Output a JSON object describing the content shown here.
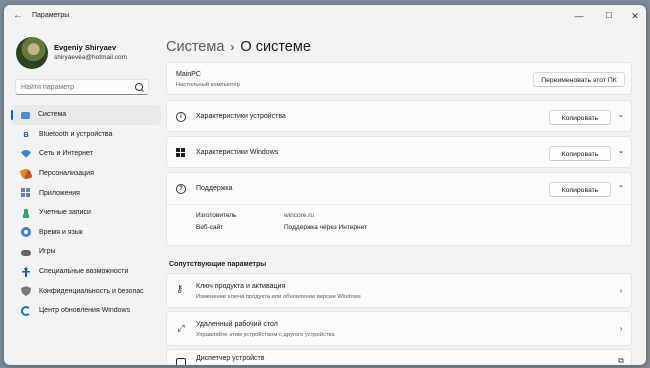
{
  "window": {
    "title": "Параметры",
    "back_glyph": "←",
    "controls": {
      "minimize": "—",
      "maximize": "☐",
      "close": "✕"
    }
  },
  "profile": {
    "name": "Evgeniy Shiryaev",
    "email": "shiryaevea@hotmail.com"
  },
  "search": {
    "placeholder": "Найти параметр"
  },
  "sidebar": {
    "items": [
      {
        "label": "Система",
        "icon": "system-icon",
        "active": true
      },
      {
        "label": "Bluetooth и устройства",
        "icon": "bluetooth-icon"
      },
      {
        "label": "Сеть и Интернет",
        "icon": "network-icon"
      },
      {
        "label": "Персонализация",
        "icon": "personalization-icon"
      },
      {
        "label": "Приложения",
        "icon": "apps-icon"
      },
      {
        "label": "Учетные записи",
        "icon": "accounts-icon"
      },
      {
        "label": "Время и язык",
        "icon": "time-language-icon"
      },
      {
        "label": "Игры",
        "icon": "games-icon"
      },
      {
        "label": "Специальные возможности",
        "icon": "accessibility-icon"
      },
      {
        "label": "Конфиденциальность и безопас",
        "icon": "privacy-icon"
      },
      {
        "label": "Центр обновления Windows",
        "icon": "windows-update-icon"
      }
    ]
  },
  "breadcrumb": {
    "parent": "Система",
    "separator": "›",
    "current": "О системе"
  },
  "device": {
    "name": "MainPC",
    "type": "Настольный компьютер",
    "rename_label": "Переименовать этот ПК"
  },
  "sections": {
    "device_specs": {
      "title": "Характеристики устройства",
      "copy_label": "Копировать"
    },
    "windows_specs": {
      "title": "Характеристики Windows",
      "copy_label": "Копировать"
    },
    "support": {
      "title": "Поддержка",
      "copy_label": "Копировать",
      "rows": [
        {
          "label": "Изготовитель",
          "value": "wincore.ru"
        },
        {
          "label": "Веб-сайт",
          "value": "Поддержка через Интернет"
        }
      ]
    }
  },
  "related": {
    "heading": "Сопутствующие параметры",
    "items": [
      {
        "title": "Ключ продукта и активация",
        "subtitle": "Изменение ключа продукта или обновление версии Windows"
      },
      {
        "title": "Удаленный рабочий стол",
        "subtitle": "Управляйте этим устройством с другого устройства"
      },
      {
        "title": "Диспетчер устройств",
        "subtitle": ""
      }
    ]
  },
  "glyphs": {
    "chevron_down": "⌄",
    "chevron_up": "⌃",
    "chevron_right": "›",
    "external": "⧉"
  },
  "colors": {
    "accent": "#0067c0",
    "background": "#f3f3f3",
    "card": "#fbfbfb"
  }
}
